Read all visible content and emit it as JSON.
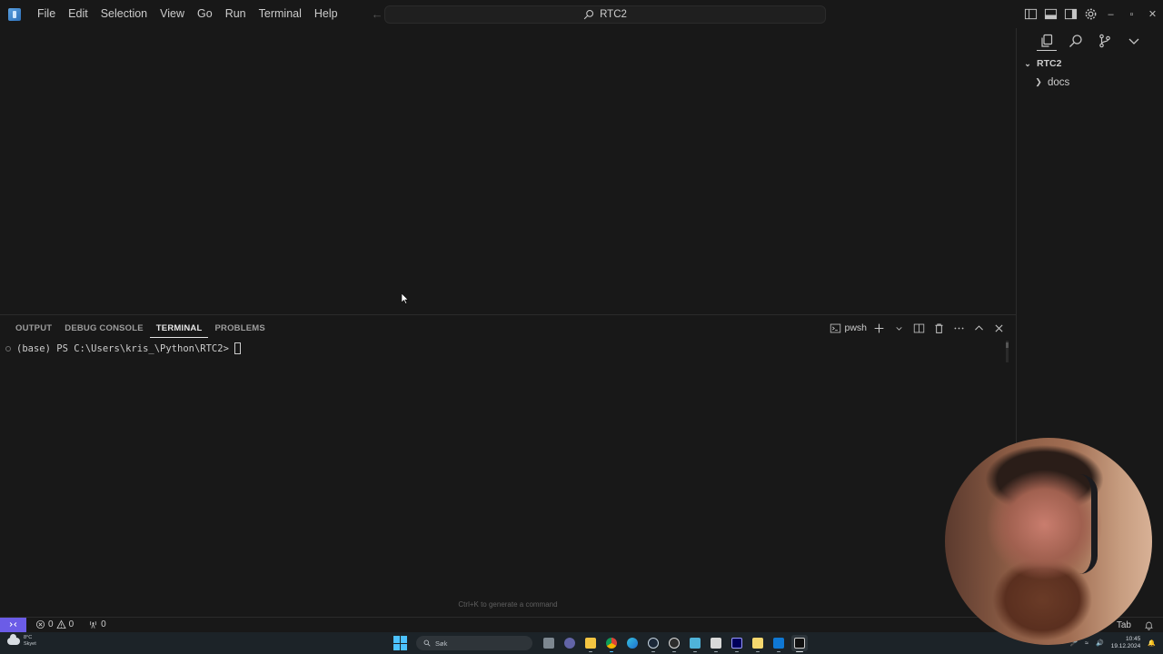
{
  "titlebar": {
    "menu": [
      "File",
      "Edit",
      "Selection",
      "View",
      "Go",
      "Run",
      "Terminal",
      "Help"
    ],
    "back_icon": "arrow-left-icon",
    "forward_icon": "arrow-right-icon",
    "command_center_text": "RTC2",
    "layout_buttons": [
      "toggle-primary-sidebar",
      "toggle-panel",
      "toggle-secondary-sidebar"
    ],
    "window_controls": {
      "minimize": "–",
      "restore": "▫",
      "close": "✕"
    }
  },
  "sidebar": {
    "tabs": [
      "explorer",
      "search",
      "source-control",
      "more"
    ],
    "root_label": "RTC2",
    "items": [
      {
        "label": "docs",
        "type": "folder",
        "expanded": false
      }
    ]
  },
  "panel": {
    "tabs": [
      {
        "label": "OUTPUT",
        "active": false
      },
      {
        "label": "DEBUG CONSOLE",
        "active": false
      },
      {
        "label": "TERMINAL",
        "active": true
      },
      {
        "label": "PROBLEMS",
        "active": false
      }
    ],
    "terminal_profile": "pwsh",
    "prompt": "(base) PS C:\\Users\\kris_\\Python\\RTC2>",
    "hint": "Ctrl+K to generate a command"
  },
  "statusbar": {
    "errors": "0",
    "warnings": "0",
    "ports": "0",
    "right_text": "Tab"
  },
  "taskbar": {
    "weather_temp": "8°C",
    "weather_desc": "Skyet",
    "search_placeholder": "Søk",
    "apps": [
      "task-view",
      "teams",
      "file-explorer",
      "chrome",
      "edge",
      "steam",
      "obs",
      "notepad",
      "notes",
      "premiere-pro",
      "sticky-notes",
      "outlook",
      "terminal"
    ],
    "time": "10:45",
    "date": "19.12.2024"
  },
  "colors": {
    "background": "#181818",
    "remote_accent": "#6b5ce7",
    "taskbar": "#1c2328"
  }
}
